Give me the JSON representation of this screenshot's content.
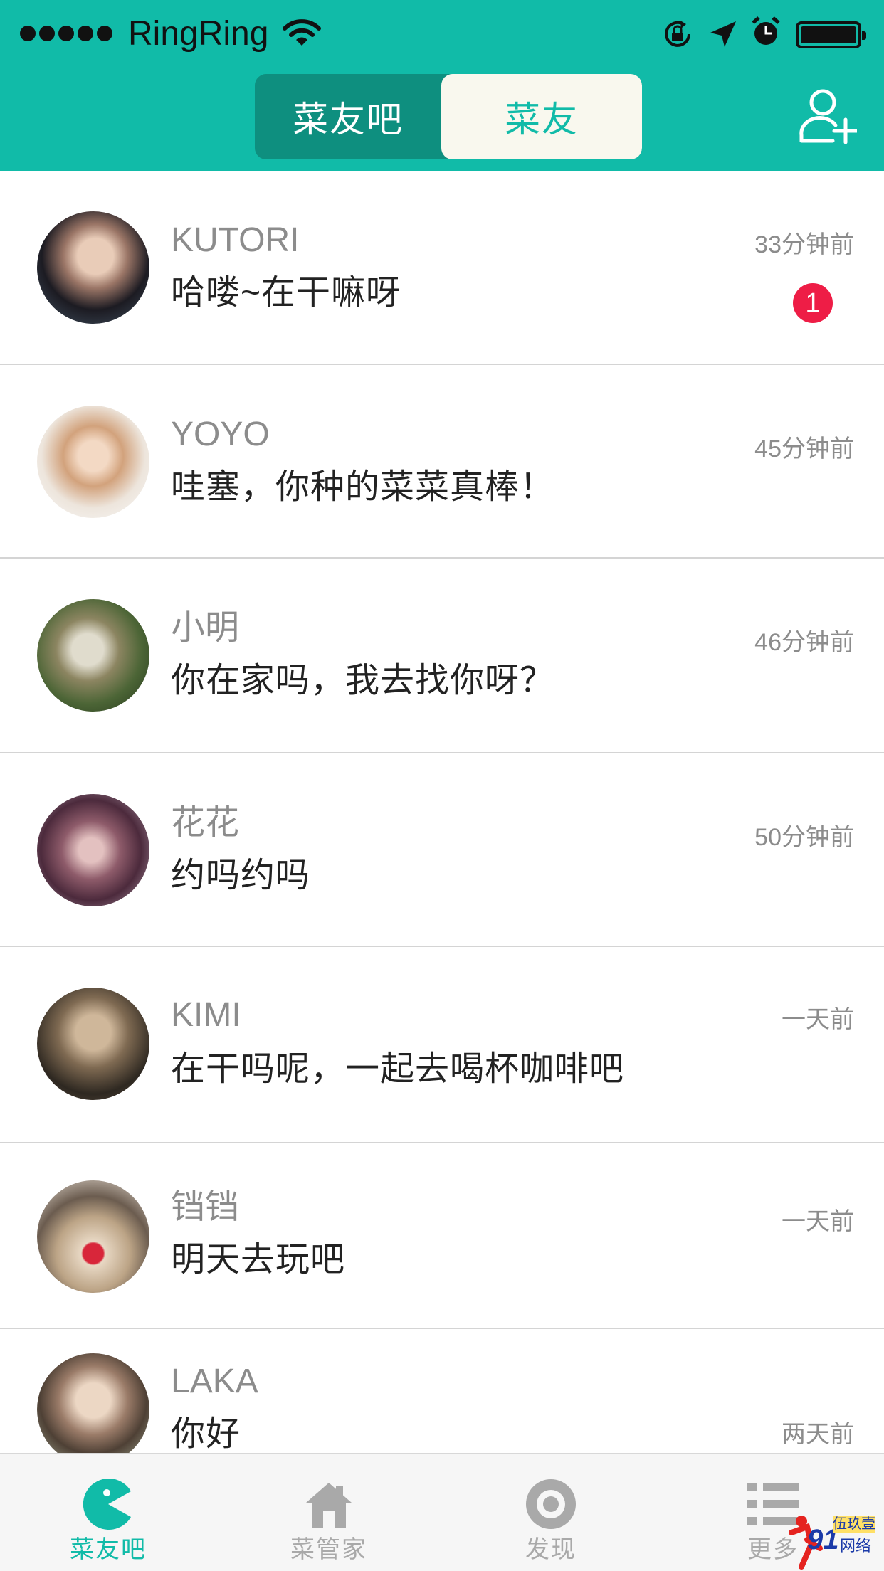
{
  "status_bar": {
    "carrier": "RingRing",
    "icons": [
      "signal-dots-icon",
      "wifi-icon",
      "rotation-lock-icon",
      "location-arrow-icon",
      "alarm-icon",
      "battery-icon"
    ]
  },
  "header": {
    "segments": [
      {
        "label": "菜友吧",
        "selected": false
      },
      {
        "label": "菜友",
        "selected": true
      }
    ],
    "add_friend_icon": "add-user-icon"
  },
  "chats": [
    {
      "name": "KUTORI",
      "message": "哈喽~在干嘛呀",
      "time": "33分钟前",
      "unread": "1"
    },
    {
      "name": "YOYO",
      "message": "哇塞，你种的菜菜真棒！",
      "time": "45分钟前"
    },
    {
      "name": "小明",
      "message": "你在家吗，我去找你呀？",
      "time": "46分钟前"
    },
    {
      "name": "花花",
      "message": "约吗约吗",
      "time": "50分钟前"
    },
    {
      "name": "KIMI",
      "message": "在干吗呢，一起去喝杯咖啡吧",
      "time": "一天前"
    },
    {
      "name": "铛铛",
      "message": "明天去玩吧",
      "time": "一天前"
    },
    {
      "name": "LAKA",
      "message": "你好",
      "time": "两天前"
    }
  ],
  "tabbar": {
    "items": [
      {
        "label": "菜友吧",
        "icon": "pacman-icon",
        "active": true
      },
      {
        "label": "菜管家",
        "icon": "house-icon",
        "active": false
      },
      {
        "label": "发现",
        "icon": "discover-target-icon",
        "active": false
      },
      {
        "label": "更多",
        "icon": "list-icon",
        "active": false
      }
    ]
  },
  "watermark": {
    "number": "91",
    "text_top": "伍玖壹",
    "text_bottom": "网络"
  },
  "colors": {
    "primary": "#11bba8",
    "primary_dark": "#0e8f7f",
    "segment_selected_bg": "#f9f8ee",
    "badge": "#ee1d46",
    "tab_inactive": "#a9a9a9"
  }
}
